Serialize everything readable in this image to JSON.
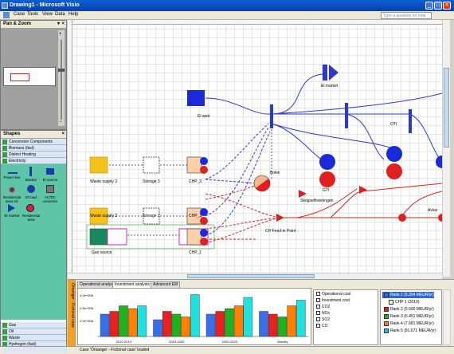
{
  "window": {
    "title": "Drawing1 - Microsoft Visio"
  },
  "menu": [
    "Case",
    "Tools",
    "View",
    "Data",
    "Help"
  ],
  "help_placeholder": "Type a question for help",
  "pan_zoom": {
    "title": "Pan & Zoom"
  },
  "shapes": {
    "title": "Shapes",
    "categories_top": [
      "Conversion Components",
      "Biomass (fast)",
      "District Heating",
      "Electricity"
    ],
    "stencils": [
      "Power line",
      "Busbar",
      "El source",
      "Residential area elc",
      "El load",
      "AC/DC converter",
      "El market",
      "Residential area"
    ],
    "categories_bottom": [
      "Gas",
      "Oil",
      "Waste",
      "Hydrogen (fast)"
    ]
  },
  "diagram": {
    "labels": {
      "el_market": "El market",
      "el_spot": "El spot",
      "boiler": "Boiler",
      "skogs": "Skogselforeningen",
      "gti": "GTI",
      "oti": "OTI",
      "avius": "Avius",
      "ch_feed": "CH Feed-in Point",
      "waste3": "Waste supply 3",
      "storage3": "Storage 3",
      "chp3": "CHP_3",
      "waste2": "Waste supply 2",
      "storage2": "Storage 2",
      "chp2": "CHP_2",
      "gas": "Gas source",
      "chp1": "CHP_1"
    }
  },
  "bottom": {
    "side_label": "Örkanger - Fictional case",
    "tabs": [
      "Operational analysis",
      "Investment analysis",
      "Advanced EM"
    ],
    "active_tab": 1,
    "legend": [
      "Operational cost",
      "Investment cost",
      "CO2",
      "NOx",
      "SO2",
      "CO"
    ],
    "ranks": [
      "Rank 1 (5.394 MEUR/yr)",
      "CHP 1 (2010)",
      "Rank 2 (5.600 MEUR/yr)",
      "Rank 3 (6.451 MEUR/yr)",
      "Rank 4 (7.681 MEUR/yr)",
      "Rank 5 (81.671 MEUR/yr)"
    ],
    "rank_colors": [
      "#3a6ee8",
      "#ffffff",
      "#e82020",
      "#20b020",
      "#ff7f00",
      "#20c0ff"
    ]
  },
  "chart_data": {
    "type": "bar",
    "title": "",
    "categories": [
      "2010-2014",
      "2015-2020",
      "2020-2025",
      "Annuity"
    ],
    "ylabel": "",
    "y_ticks": [
      "3.0e+006",
      "2.5e+006",
      "2.0e+006"
    ],
    "series": [
      {
        "name": "Rank 1 (5.394 MEUR/yr)",
        "color": "#3a6ee8",
        "values": [
          2.6,
          2.4,
          2.6,
          2.7
        ]
      },
      {
        "name": "Rank 2 (5.600 MEUR/yr)",
        "color": "#e82020",
        "values": [
          2.7,
          2.7,
          2.7,
          2.6
        ]
      },
      {
        "name": "Rank 3 (6.451 MEUR/yr)",
        "color": "#20b020",
        "values": [
          2.9,
          2.6,
          2.8,
          2.5
        ]
      },
      {
        "name": "Rank 4 (7.681 MEUR/yr)",
        "color": "#ff7f00",
        "values": [
          2.8,
          2.5,
          2.9,
          2.9
        ]
      },
      {
        "name": "Rank 5 (81.671 MEUR/yr)",
        "color": "#20e0e0",
        "values": [
          2.9,
          3.3,
          3.2,
          3.1
        ]
      }
    ],
    "ylim": [
      1.8,
      3.4
    ]
  },
  "status": {
    "text": "Case 'Örkanger - Fictional case' loaded"
  }
}
